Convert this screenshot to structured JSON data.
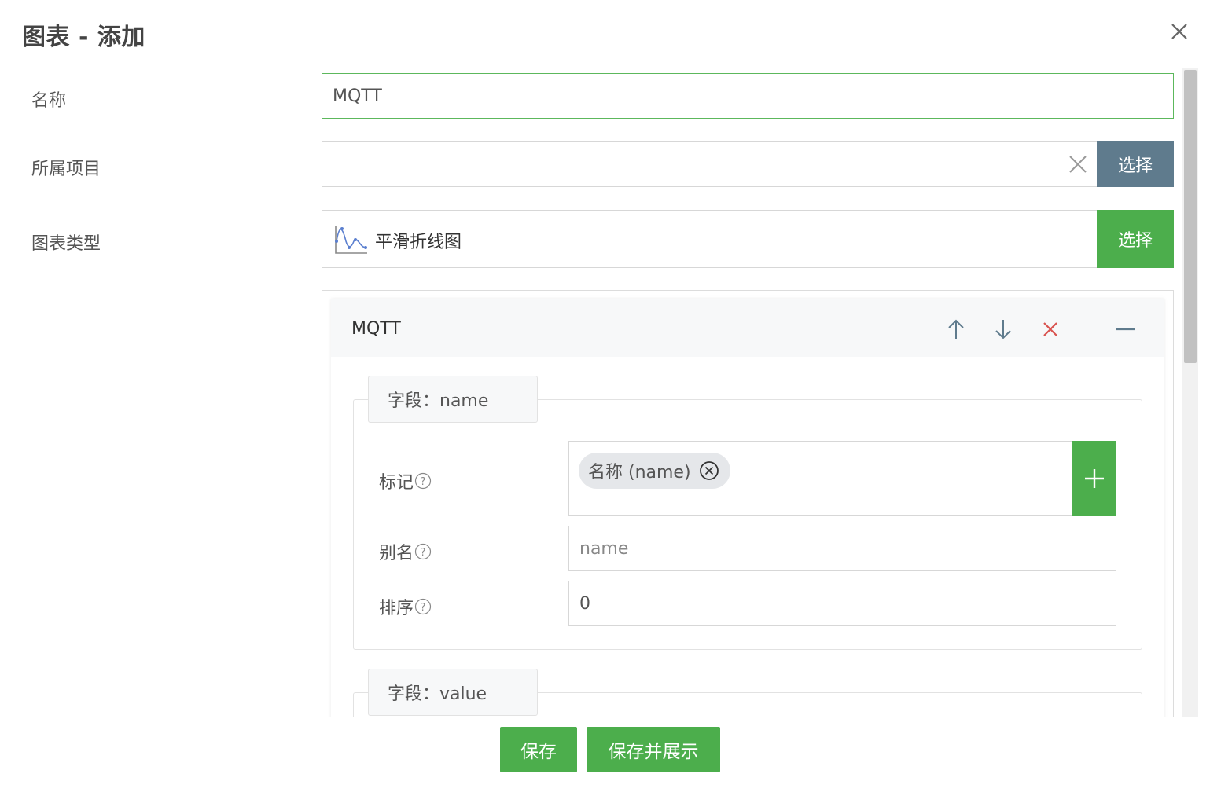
{
  "dialog": {
    "title": "图表 - 添加"
  },
  "form": {
    "name": {
      "label": "名称",
      "value": "MQTT"
    },
    "project": {
      "label": "所属项目",
      "value": "",
      "select_label": "选择"
    },
    "chart_type": {
      "label": "图表类型",
      "value": "平滑折线图",
      "select_label": "选择"
    }
  },
  "series": {
    "title": "MQTT",
    "fields": [
      {
        "legend": "字段：name",
        "mark": {
          "label": "标记",
          "tags": [
            "名称 (name)"
          ]
        },
        "alias": {
          "label": "别名",
          "placeholder": "name"
        },
        "sort": {
          "label": "排序",
          "value": "0"
        }
      },
      {
        "legend": "字段：value"
      }
    ]
  },
  "footer": {
    "save_label": "保存",
    "save_show_label": "保存并展示"
  },
  "colors": {
    "primary": "#4cae4c",
    "slate": "#5f7b8d",
    "danger": "#d9534f"
  }
}
